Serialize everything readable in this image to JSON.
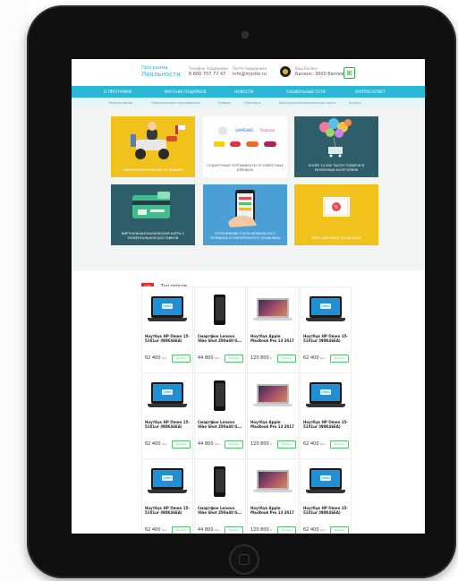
{
  "header": {
    "brand_line1": "Программа",
    "brand_line2": "Лояльности",
    "phone_label": "Телефон поддержки",
    "phone": "8 800 707 77 47",
    "email_label": "Почта поддержки",
    "email": "info@mysite.ru",
    "balance_label": "Ваш баланс",
    "balance": "Баланс: 3000 баллов"
  },
  "nav": {
    "items": [
      "О ПРОГРАММЕ",
      "МАГАЗИН ПОДАРКОВ",
      "НОВОСТИ",
      "СОЦИАЛЬНЫЕ СЕТИ",
      "ВОПРОС/ОТВЕТ"
    ]
  },
  "subnav": {
    "items": [
      "Впечатления",
      "Электронные сертификаты",
      "Товары",
      "Платежи",
      "Виртуальная банковская карта",
      "Услуги"
    ]
  },
  "tiles": [
    {
      "caption": "ТЫСЯЧИ ВПЕЧАТЛЕНИЙ ОТ ВЫБОРА"
    },
    {
      "caption": "ПОДАРОЧНЫЕ СЕРТИФИКАТЫ ОТ ИЗВЕСТНЫХ БРЕНДОВ"
    },
    {
      "caption": "БОЛЕЕ 10 000 ТЫСЯЧ ТОВАРОВ В РАЗЛИЧНЫХ КАТЕГОРИЯХ"
    },
    {
      "caption": "ВИРТУАЛЬНАЯ БАНКОВСКАЯ КАРТА С МОМЕНТАЛЬНОЙ ДОСТАВКОЙ"
    },
    {
      "caption": "ПОПОЛНЕНИЕ СЧЕТА МОБИЛЬНОГО ТЕЛЕФОНА И ЭЛЕКТРОННОГО КОШЕЛЬКА"
    },
    {
      "caption": "МЕГА ДИСКАУНТ ПО БАЛЛАМ"
    }
  ],
  "section": {
    "badge": "TOP",
    "title": "Топ просов"
  },
  "products": [
    {
      "name": "Ноутбук HP Omen 15-5101ur (N0K46EA)",
      "price": "62 400",
      "unit": "бал",
      "buy": "Купить",
      "kind": "laptop"
    },
    {
      "name": "Смартфон Lenovo Vibe Shot Z90a40 G...",
      "price": "44 800",
      "unit": "бал",
      "buy": "Купить",
      "kind": "phone"
    },
    {
      "name": "Ноутбук Apple MacBook Pro 13 2017",
      "price": "120 800",
      "unit": "б",
      "buy": "Купить",
      "kind": "mac"
    },
    {
      "name": "Ноутбук HP Omen 15-5101ur (N0K46EA)",
      "price": "62 400",
      "unit": "бал",
      "buy": "Купить",
      "kind": "laptop"
    },
    {
      "name": "Ноутбук HP Omen 15-5101ur (N0K46EA)",
      "price": "62 400",
      "unit": "бал",
      "buy": "Купить",
      "kind": "laptop"
    },
    {
      "name": "Смартфон Lenovo Vibe Shot Z90a40 G...",
      "price": "44 800",
      "unit": "бал",
      "buy": "Купить",
      "kind": "phone"
    },
    {
      "name": "Ноутбук Apple MacBook Pro 13 2017",
      "price": "120 800",
      "unit": "б",
      "buy": "Купить",
      "kind": "mac"
    },
    {
      "name": "Ноутбук HP Omen 15-5101ur (N0K46EA)",
      "price": "62 400",
      "unit": "бал",
      "buy": "Купить",
      "kind": "laptop"
    },
    {
      "name": "Ноутбук HP Omen 15-5101ur (N0K46EA)",
      "price": "62 400",
      "unit": "бал",
      "buy": "Купить",
      "kind": "laptop"
    },
    {
      "name": "Смартфон Lenovo Vibe Shot Z90a40 G...",
      "price": "44 800",
      "unit": "бал",
      "buy": "Купить",
      "kind": "phone"
    },
    {
      "name": "Ноутбук Apple MacBook Pro 13 2017",
      "price": "120 800",
      "unit": "б",
      "buy": "Купить",
      "kind": "mac"
    },
    {
      "name": "Ноутбук HP Omen 15-5101ur (N0K46EA)",
      "price": "62 400",
      "unit": "бал",
      "buy": "Купить",
      "kind": "laptop"
    }
  ],
  "hp_logo": "OMEN",
  "colors": {
    "accent": "#2ab7d5",
    "tile_yellow": "#f2c21c",
    "tile_teal": "#2d5e6a",
    "tile_blue": "#4a9fd6",
    "buy_green": "#51c66a",
    "badge_red": "#e22a2a"
  }
}
